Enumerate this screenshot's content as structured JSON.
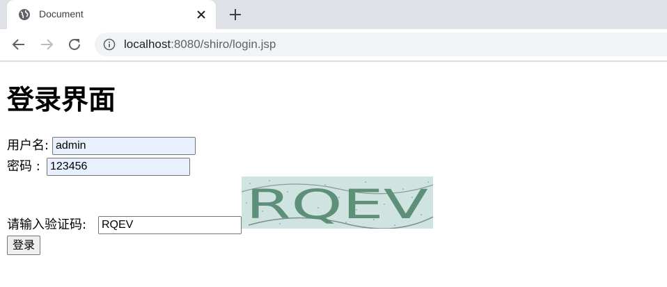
{
  "browser": {
    "tab_title": "Document",
    "url_host": "localhost",
    "url_rest": ":8080/shiro/login.jsp"
  },
  "page": {
    "title": "登录界面",
    "username_label": "用户名:",
    "username_value": "admin",
    "password_label": "密码 :",
    "password_value": "123456",
    "captcha_label": "请输入验证码:",
    "captcha_value": "RQEV",
    "captcha_text": "RQEV",
    "submit_label": "登录"
  },
  "colors": {
    "autofill_bg": "#e8f0fe",
    "captcha_bg": "#cfe3e0",
    "captcha_glyph": "#5e8f78"
  },
  "icons": {
    "favicon": "globe-icon",
    "tab_close": "close-icon",
    "new_tab": "plus-icon",
    "back": "arrow-left-icon",
    "forward": "arrow-right-icon",
    "reload": "reload-icon",
    "site_info": "info-icon"
  }
}
